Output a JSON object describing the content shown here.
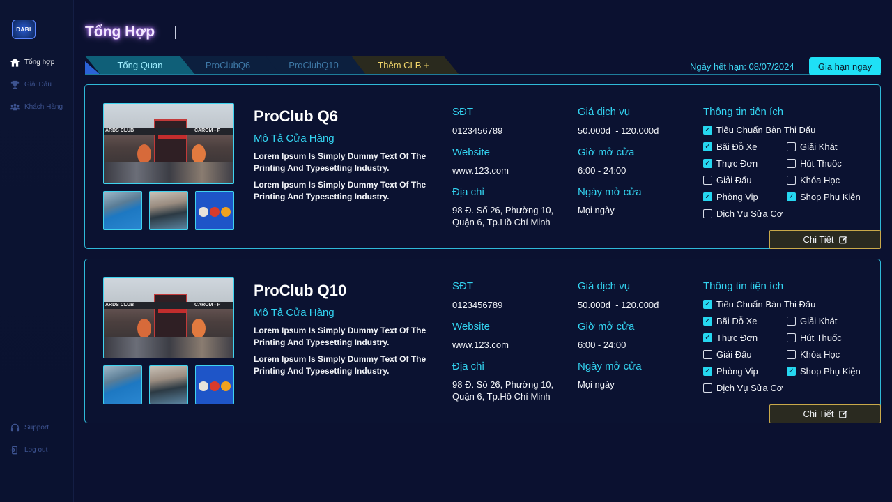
{
  "sidebar": {
    "logo_text": "DABI",
    "items": [
      {
        "label": "Tổng hợp",
        "icon": "home-icon",
        "active": true
      },
      {
        "label": "Giải Đấu",
        "icon": "trophy-icon",
        "active": false
      },
      {
        "label": "Khách Hàng",
        "icon": "users-icon",
        "active": false
      }
    ],
    "bottom": [
      {
        "label": "Support",
        "icon": "headset-icon"
      },
      {
        "label": "Log out",
        "icon": "logout-icon"
      }
    ]
  },
  "header": {
    "title": "Tổng Hợp"
  },
  "tabs": [
    {
      "label": "Tổng Quan",
      "active": true
    },
    {
      "label": "ProClubQ6",
      "active": false
    },
    {
      "label": "ProClubQ10",
      "active": false
    },
    {
      "label": "Thêm CLB +",
      "active": false
    }
  ],
  "subscription": {
    "expiry_text": "Ngày hết hạn: 08/07/2024",
    "renew_label": "Gia hạn ngay"
  },
  "labels": {
    "store_desc": "Mô Tả Cửa Hàng",
    "phone": "SĐT",
    "website": "Website",
    "address": "Địa chỉ",
    "price": "Giá dịch vụ",
    "hours": "Giờ mở cửa",
    "open_days": "Ngày mở cửa",
    "amenities": "Thông tin tiện ích",
    "detail_button": "Chi Tiết"
  },
  "clubs": [
    {
      "name": "ProClub Q6",
      "description": [
        "Lorem Ipsum Is Simply Dummy Text Of The Printing And Typesetting Industry.",
        "Lorem Ipsum Is Simply Dummy Text Of The Printing And Typesetting Industry."
      ],
      "phone": "0123456789",
      "website": "www.123.com",
      "address_line1": "98 Đ. Số 26, Phường 10,",
      "address_line2": "Quận 6, Tp.Hồ Chí Minh",
      "price": "50.000đ  - 120.000đ",
      "hours": "6:00 - 24:00",
      "open_days": "Mọi ngày",
      "image_sign_left": "ARDS CLUB",
      "image_sign_right": "CAROM - P",
      "amenities": [
        {
          "label": "Tiêu Chuẩn Bàn Thi Đấu",
          "checked": true
        },
        {
          "label": "Bãi Đỗ Xe",
          "checked": true
        },
        {
          "label": "Giải Khát",
          "checked": false
        },
        {
          "label": "Thực Đơn",
          "checked": true
        },
        {
          "label": "Hút Thuốc",
          "checked": false
        },
        {
          "label": "Giải Đấu",
          "checked": false
        },
        {
          "label": "Khóa Học",
          "checked": false
        },
        {
          "label": "Phòng Vip",
          "checked": true
        },
        {
          "label": "Shop Phụ Kiện",
          "checked": true
        },
        {
          "label": "Dịch Vụ Sửa Cơ",
          "checked": false
        }
      ]
    },
    {
      "name": "ProClub Q10",
      "description": [
        "Lorem Ipsum Is Simply Dummy Text Of The Printing And Typesetting Industry.",
        "Lorem Ipsum Is Simply Dummy Text Of The Printing And Typesetting Industry."
      ],
      "phone": "0123456789",
      "website": "www.123.com",
      "address_line1": "98 Đ. Số 26, Phường 10,",
      "address_line2": "Quận 6, Tp.Hồ Chí Minh",
      "price": "50.000đ  - 120.000đ",
      "hours": "6:00 - 24:00",
      "open_days": "Mọi ngày",
      "image_sign_left": "ARDS CLUB",
      "image_sign_right": "CAROM - P",
      "amenities": [
        {
          "label": "Tiêu Chuẩn Bàn Thi Đấu",
          "checked": true
        },
        {
          "label": "Bãi Đỗ Xe",
          "checked": true
        },
        {
          "label": "Giải Khát",
          "checked": false
        },
        {
          "label": "Thực Đơn",
          "checked": true
        },
        {
          "label": "Hút Thuốc",
          "checked": false
        },
        {
          "label": "Giải Đấu",
          "checked": false
        },
        {
          "label": "Khóa Học",
          "checked": false
        },
        {
          "label": "Phòng Vip",
          "checked": true
        },
        {
          "label": "Shop Phụ Kiện",
          "checked": true
        },
        {
          "label": "Dịch Vụ Sửa Cơ",
          "checked": false
        }
      ]
    }
  ],
  "colors": {
    "accent": "#33d3f0",
    "background": "#0b1130",
    "gold": "#c9a94a"
  }
}
